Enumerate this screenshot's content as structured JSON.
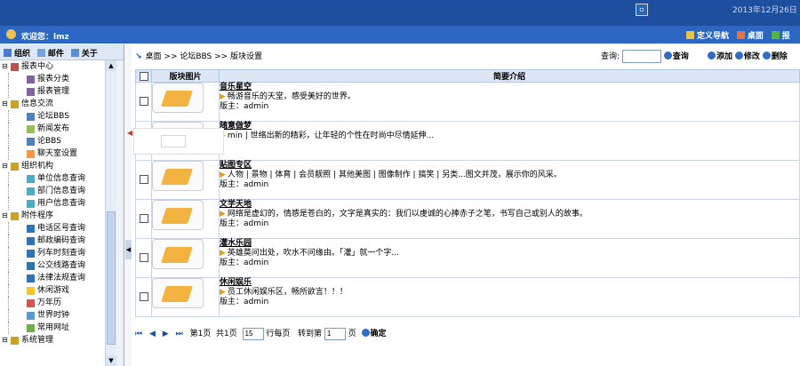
{
  "topbar": {
    "window_icon": "▫",
    "date": "2013年12月26日 星"
  },
  "welcome": {
    "text": "欢迎您：lmz",
    "tools": [
      "定义导航",
      "桌面",
      "报"
    ]
  },
  "sidebar": {
    "tabs": [
      "组织",
      "邮件",
      "关于"
    ],
    "tree": [
      {
        "label": "报表中心",
        "level": 0,
        "icon": "chart-icon"
      },
      {
        "label": "报表分类",
        "level": 1,
        "icon": "report-icon"
      },
      {
        "label": "报表管理",
        "level": 1,
        "icon": "report-icon"
      },
      {
        "label": "信息交流",
        "level": 0,
        "icon": "folder-icon"
      },
      {
        "label": "论坛BBS",
        "level": 1,
        "icon": "bbs-icon"
      },
      {
        "label": "新闻发布",
        "level": 1,
        "icon": "news-icon"
      },
      {
        "label": "论BBS",
        "level": 1,
        "icon": "bbs-icon"
      },
      {
        "label": "聊天室设置",
        "level": 1,
        "icon": "chat-icon"
      },
      {
        "label": "组织机构",
        "level": 0,
        "icon": "folder-icon"
      },
      {
        "label": "单位信息查询",
        "level": 1,
        "icon": "info-icon"
      },
      {
        "label": "部门信息查询",
        "level": 1,
        "icon": "info-icon"
      },
      {
        "label": "用户信息查询",
        "level": 1,
        "icon": "info-icon"
      },
      {
        "label": "附件程序",
        "level": 0,
        "icon": "folder-icon"
      },
      {
        "label": "电话区号查询",
        "level": 1,
        "icon": "globe-icon"
      },
      {
        "label": "邮政编码查询",
        "level": 1,
        "icon": "globe-icon"
      },
      {
        "label": "列车时刻查询",
        "level": 1,
        "icon": "globe-icon"
      },
      {
        "label": "公交线路查询",
        "level": 1,
        "icon": "globe-icon"
      },
      {
        "label": "法律法规查询",
        "level": 1,
        "icon": "globe-icon"
      },
      {
        "label": "休闲游戏",
        "level": 1,
        "icon": "star-icon"
      },
      {
        "label": "万年历",
        "level": 1,
        "icon": "calendar-icon"
      },
      {
        "label": "世界时钟",
        "level": 1,
        "icon": "clock-icon"
      },
      {
        "label": "常用网址",
        "level": 1,
        "icon": "link-icon"
      },
      {
        "label": "系统管理",
        "level": 0,
        "icon": "folder-icon"
      }
    ]
  },
  "breadcrumb": {
    "arrow": "↘",
    "text": "桌面 >> 论坛BBS >> 版块设置"
  },
  "toolbar": {
    "query_label": "查询:",
    "query_button": "查询",
    "add": "添加",
    "edit": "修改",
    "delete": "删除"
  },
  "table": {
    "headers": [
      "版块图片",
      "简要介绍"
    ],
    "rows": [
      {
        "title": "音乐星空",
        "desc": "畅游音乐的天堂，感受美好的世界。",
        "moderator": "版主：admin"
      },
      {
        "title": "随意做梦",
        "desc": "min   | 世络出新的精彩，让年轻的个性在时尚中尽情延伸...",
        "moderator": ""
      },
      {
        "title": "贴图专区",
        "desc": "人物 | 景物 | 体育 | 会员靓照 | 其他美图 | 图像制作 | 搞笑 | 另类...图文并茂，展示你的风采。",
        "moderator": "版主：admin"
      },
      {
        "title": "文学天地",
        "desc": "网络是虚幻的，情感是苍白的，文字是真实的：我们以虔诚的心捧赤子之笔，书写自己或别人的故事。",
        "moderator": "版主：admin"
      },
      {
        "title": "灌水乐园",
        "desc": "英雄莫问出处，吹水不问缘由。「灌」就一个字...",
        "moderator": "版主：admin"
      },
      {
        "title": "休闲娱乐",
        "desc": "员工休闲娱乐区，畅所欲言！！！",
        "moderator": "版主：admin"
      }
    ]
  },
  "pager": {
    "page_info": "第1页",
    "total": "共1页",
    "per_page": "15",
    "per_page_label": "行每页",
    "goto_label": "转到第",
    "goto_value": "1",
    "page_suffix": "页",
    "confirm": "确定"
  },
  "colors": {
    "accent": "#1d4f9e",
    "header_blue": "#2b66c2",
    "thumb_orange": "#f2b340"
  }
}
